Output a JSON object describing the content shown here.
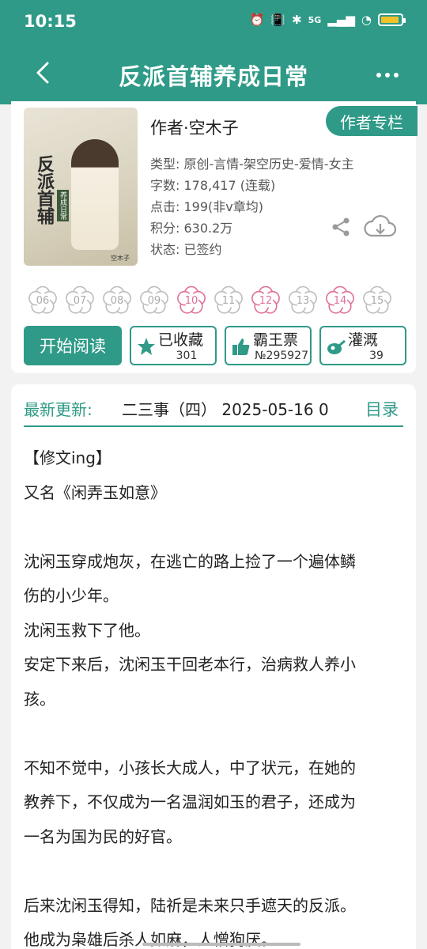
{
  "status": {
    "time": "10:15",
    "network": "5G"
  },
  "nav": {
    "title": "反派首辅养成日常"
  },
  "book": {
    "cover_calligraphy": "反派首辅",
    "cover_seal": "养成日常",
    "cover_signature": "空木子",
    "author_line": "作者·空木子",
    "author_button": "作者专栏",
    "meta": [
      "类型: 原创-言情-架空历史-爱情-女主",
      "字数: 178,417 (连载)",
      "点击: 199(非v章均)",
      "积分: 630.2万",
      "状态: 已签约"
    ]
  },
  "flowers": [
    {
      "label": "06",
      "color": "#bdbdbd"
    },
    {
      "label": "07",
      "color": "#bdbdbd"
    },
    {
      "label": "08",
      "color": "#bdbdbd"
    },
    {
      "label": "09",
      "color": "#bdbdbd"
    },
    {
      "label": "10",
      "color": "#e06f9a"
    },
    {
      "label": "11",
      "color": "#bdbdbd"
    },
    {
      "label": "12",
      "color": "#e06f9a"
    },
    {
      "label": "13",
      "color": "#bdbdbd"
    },
    {
      "label": "14",
      "color": "#e06f9a"
    },
    {
      "label": "15",
      "color": "#bdbdbd"
    }
  ],
  "buttons": {
    "read": "开始阅读",
    "favorite": {
      "label": "已收藏",
      "count": "301"
    },
    "ticket": {
      "label": "霸王票",
      "count": "№295927"
    },
    "irrigate": {
      "label": "灌溉",
      "count": "39"
    }
  },
  "update": {
    "label": "最新更新:",
    "value": "二三事（四） 2025-05-16 0",
    "toc": "目录"
  },
  "description": [
    "【修文ing】",
    "又名《闲弄玉如意》",
    "",
    "沈闲玉穿成炮灰，在逃亡的路上捡了一个遍体鳞",
    "伤的小少年。",
    "沈闲玉救下了他。",
    "安定下来后，沈闲玉干回老本行，治病救人养小",
    "孩。",
    "",
    "不知不觉中，小孩长大成人，中了状元，在她的",
    "教养下，不仅成为一名温润如玉的君子，还成为",
    "一名为国为民的好官。",
    "",
    "后来沈闲玉得知，陆祈是未来只手遮天的反派。",
    "他成为枭雄后杀人如麻，人憎狗厌。"
  ],
  "colors": {
    "accent": "#2e9a87",
    "flower_pink": "#e06f9a",
    "flower_grey": "#bdbdbd"
  }
}
